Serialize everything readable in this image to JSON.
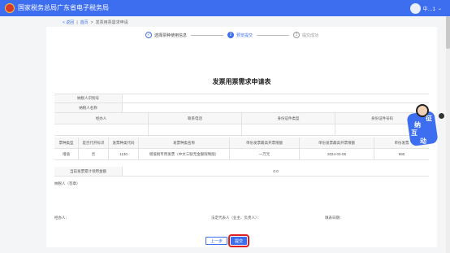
{
  "header": {
    "title": "国家税务总局广东省电子税务局",
    "user_name": "中…1",
    "chevron": "⌄"
  },
  "breadcrumb": {
    "back": "< 返回",
    "sep": "|",
    "home": "首页",
    "sep2": ">",
    "current": "发票用票需求申请"
  },
  "steps": [
    {
      "num": "✓",
      "label": "选择票种使用信息"
    },
    {
      "num": "2",
      "label": "预览提交"
    },
    {
      "num": "3",
      "label": "提交成功"
    }
  ],
  "form": {
    "title": "发票用票需求申请表",
    "taxpayer_id_label": "纳税人识别号",
    "taxpayer_name_label": "纳税人名称",
    "contact_headers": [
      "经办人",
      "联系电话",
      "身份证件类型",
      "身份证件号码"
    ],
    "invoice_headers": [
      "票种类型",
      "是否代开标识",
      "发票种类代码",
      "发票种类名称",
      "单份发票最高开票限额",
      "单份发票最高开票限额",
      "单份发票"
    ],
    "invoice_rows": [
      {
        "type": "增值",
        "proxy": "否",
        "code": "1130",
        "name": "增值税专用发票（中文三联无金额限制版）",
        "limit": "一万元",
        "date": "2024-03-08",
        "last": "990"
      }
    ],
    "total_label": "当前发票累计领用金额",
    "total_value": "0.0",
    "remark_label": "纳税人（签章）",
    "sign_fields": [
      "经办人：",
      "法定代表人（业主、负责人）：",
      "填表日期："
    ]
  },
  "buttons": {
    "prev": "上一步",
    "submit": "提交"
  },
  "widget": {
    "chars": [
      "征",
      "纳",
      "互",
      "动"
    ]
  }
}
